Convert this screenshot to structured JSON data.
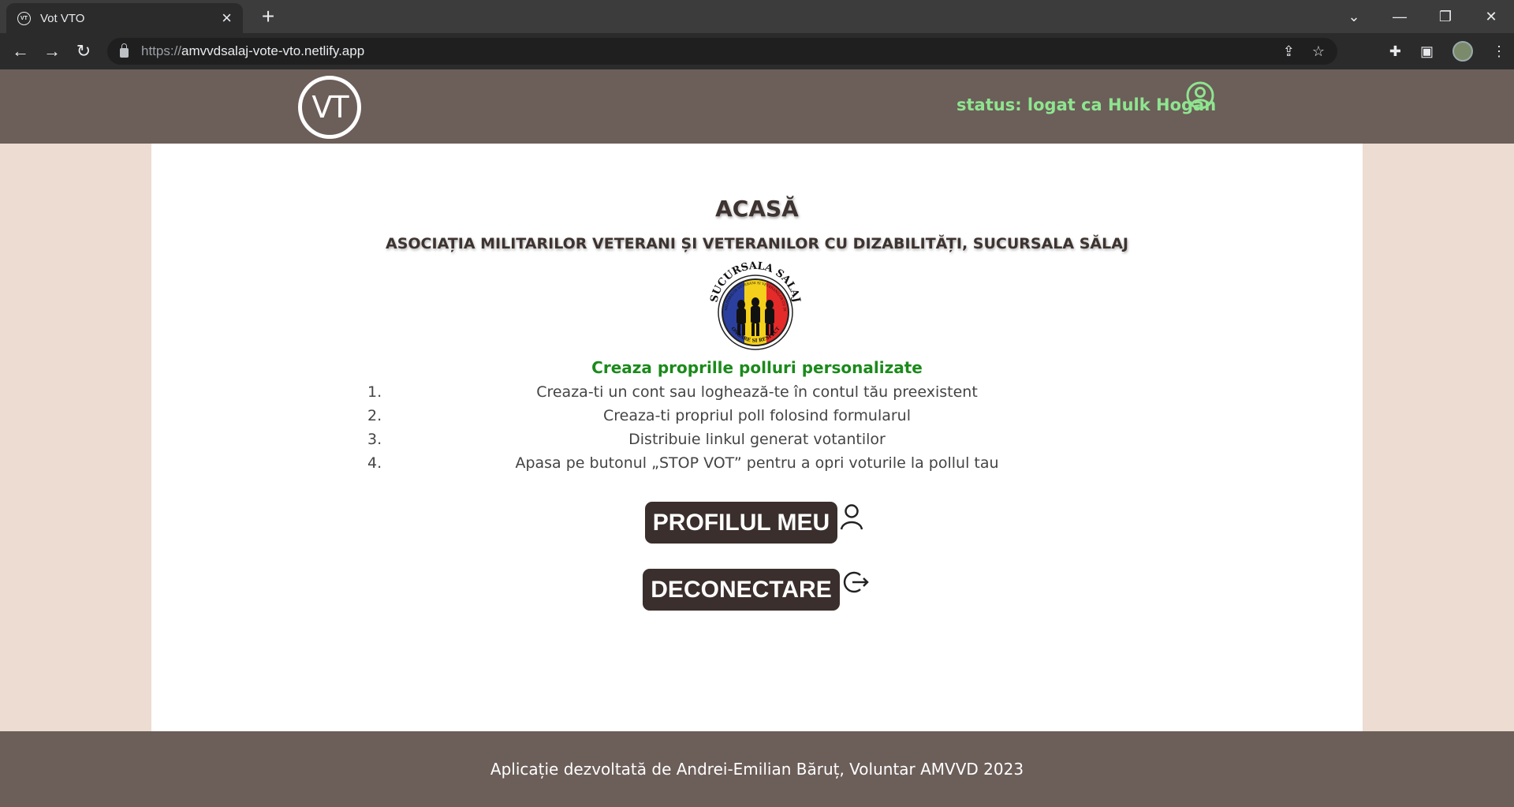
{
  "browser": {
    "tab_title": "Vot VTO",
    "favicon_text": "VT",
    "url_scheme": "https://",
    "url_host": "amvvdsalaj-vote-vto.netlify.app"
  },
  "header": {
    "logo_text": "VT",
    "status": "status: logat ca Hulk Hogan"
  },
  "main": {
    "title": "ACASĂ",
    "subtitle": "ASOCIAȚIA MILITARILOR VETERANI ȘI VETERANILOR CU DIZABILITĂȚI, SUCURSALA SĂLAJ",
    "emblem": {
      "top_text": "SUCURSALA SALAJ",
      "ring_text": "ASOCIATIA MILITARILOR VETERANI SI VETERANILOR CU DIZABILITATI",
      "bottom_text": "ONOARE SI RESPECT"
    },
    "steps_heading": "Creaza proprille polluri personalizate",
    "steps": [
      {
        "num": "1.",
        "text": "Creaza-ti un cont sau loghează-te în contul tău preexistent"
      },
      {
        "num": "2.",
        "text": "Creaza-ti propriul poll folosind formularul"
      },
      {
        "num": "3.",
        "text": "Distribuie linkul generat votantilor"
      },
      {
        "num": "4.",
        "text": "Apasa pe butonul „STOP VOT” pentru a opri voturile la pollul tau"
      }
    ],
    "profile_button": "PROFILUL MEU",
    "logout_button": "DECONECTARE"
  },
  "footer": {
    "text": "Aplicație dezvoltată de Andrei-Emilian Băruț, Voluntar AMVVD 2023"
  },
  "colors": {
    "header_bg": "#6c5e59",
    "page_bg": "#ecdcd1",
    "status_green": "#8ee58f",
    "heading_green": "#1b8a1b",
    "button_bg": "#3a2f2c"
  }
}
